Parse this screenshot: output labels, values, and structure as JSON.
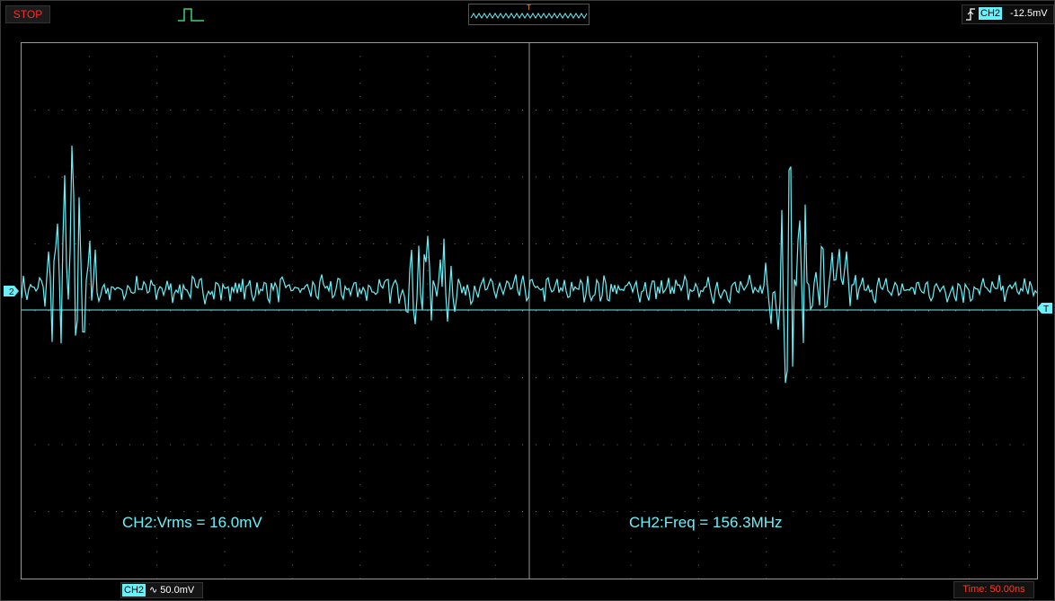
{
  "status": {
    "run_state": "STOP"
  },
  "trigger": {
    "channel": "CH2",
    "level": "-12.5mV",
    "overview_marker": "T",
    "edge": "rising-edge-icon"
  },
  "channel": {
    "label": "CH2",
    "coupling_symbol": "∿",
    "scale": "50.0mV",
    "marker_label": "2",
    "color": "#6af0f8"
  },
  "timebase": {
    "text": "Time: 50.00ns"
  },
  "measurements": [
    {
      "text": "CH2:Vrms = 16.0mV"
    },
    {
      "text": "CH2:Freq = 156.3MHz"
    }
  ],
  "trigger_marker_label": "T",
  "colors": {
    "trace": "#6af0f8",
    "stop": "#ff2a2a",
    "time": "#ff3b1f",
    "grid": "#9a9a9a"
  }
}
